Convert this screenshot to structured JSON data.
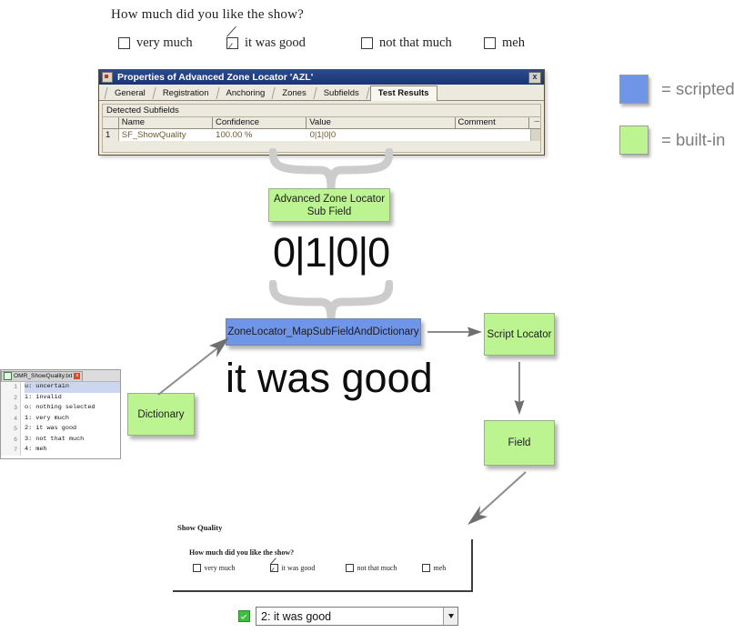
{
  "survey_top": {
    "question": "How much did you like the show?",
    "options": [
      {
        "label": "very much",
        "checked": false
      },
      {
        "label": "it was good",
        "checked": true
      },
      {
        "label": "not that much",
        "checked": false
      },
      {
        "label": "meh",
        "checked": false
      }
    ]
  },
  "legend": {
    "items": [
      {
        "label": "= scripted",
        "color": "#6f95e8"
      },
      {
        "label": "= built-in",
        "color": "#bdf492"
      }
    ]
  },
  "azl_dialog": {
    "title": "Properties of Advanced Zone Locator 'AZL'",
    "close_label": "x",
    "tabs": [
      {
        "label": "General",
        "active": false
      },
      {
        "label": "Registration",
        "active": false
      },
      {
        "label": "Anchoring",
        "active": false
      },
      {
        "label": "Zones",
        "active": false
      },
      {
        "label": "Subfields",
        "active": false
      },
      {
        "label": "Test Results",
        "active": true
      }
    ],
    "panel_title": "Detected Subfields",
    "columns": [
      "",
      "Name",
      "Confidence",
      "Value",
      "Comment",
      ""
    ],
    "rows": [
      {
        "index": "1",
        "name": "SF_ShowQuality",
        "confidence": "100.00 %",
        "value": "0|1|0|0",
        "comment": ""
      }
    ]
  },
  "flow": {
    "azl_subfield_box": "Advanced Zone Locator\nSub Field",
    "azl_subfield_line1": "Advanced Zone Locator",
    "azl_subfield_line2": "Sub Field",
    "raw_value": "0|1|0|0",
    "zone_locator_box": "ZoneLocator_MapSubFieldAndDictionary",
    "mapped_value": "it was good",
    "script_locator_box": "Script Locator",
    "dictionary_box": "Dictionary",
    "field_box": "Field"
  },
  "dictionary_file": {
    "tab_name": "OMR_ShowQuality.txt",
    "close_label": "x",
    "lines": [
      {
        "num": "1",
        "text": "u: uncertain",
        "highlight": true
      },
      {
        "num": "2",
        "text": "i: invalid",
        "highlight": false
      },
      {
        "num": "3",
        "text": "o: nothing selected",
        "highlight": false
      },
      {
        "num": "4",
        "text": "1: very much",
        "highlight": false
      },
      {
        "num": "5",
        "text": "2: it was good",
        "highlight": false
      },
      {
        "num": "6",
        "text": "3: not that much",
        "highlight": false
      },
      {
        "num": "7",
        "text": "4: meh",
        "highlight": false
      }
    ]
  },
  "scan_form": {
    "title": "Show Quality",
    "question": "How much did you like the show?",
    "options": [
      {
        "label": "very much",
        "checked": false
      },
      {
        "label": "it was good",
        "checked": true
      },
      {
        "label": "not that much",
        "checked": false
      },
      {
        "label": "meh",
        "checked": false
      }
    ],
    "dropdown_value": "2: it was good"
  }
}
